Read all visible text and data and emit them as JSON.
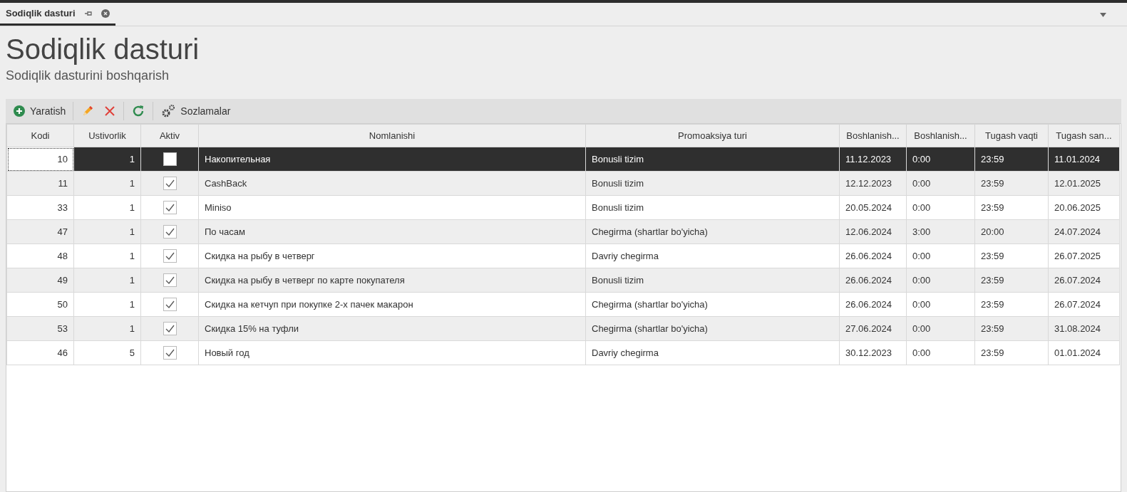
{
  "tabs": [
    {
      "label": "Sodiqlik dasturi",
      "selected": true
    }
  ],
  "page": {
    "title": "Sodiqlik dasturi",
    "subtitle": "Sodiqlik dasturini boshqarish"
  },
  "toolbar": [
    {
      "kind": "create",
      "label": "Yaratish"
    },
    {
      "kind": "edit"
    },
    {
      "kind": "delete"
    },
    {
      "kind": "refresh"
    },
    {
      "kind": "settings",
      "label": "Sozlamalar"
    }
  ],
  "table": {
    "columns": [
      "Kodi",
      "Ustivorlik",
      "Aktiv",
      "Nomlanishi",
      "Promoaksiya turi",
      "Boshlanish...",
      "Boshlanish...",
      "Tugash vaqti",
      "Tugash san..."
    ],
    "rows": [
      {
        "selected": true,
        "kodi": "10",
        "ustivorlik": "1",
        "aktiv": false,
        "name": "Накопительная",
        "type": "Bonusli tizim",
        "start_date": "11.12.2023",
        "start_time": "0:00",
        "end_time": "23:59",
        "end_date": "11.01.2024"
      },
      {
        "selected": false,
        "kodi": "11",
        "ustivorlik": "1",
        "aktiv": true,
        "name": "CashBack",
        "type": "Bonusli tizim",
        "start_date": "12.12.2023",
        "start_time": "0:00",
        "end_time": "23:59",
        "end_date": "12.01.2025"
      },
      {
        "selected": false,
        "kodi": "33",
        "ustivorlik": "1",
        "aktiv": true,
        "name": "Miniso",
        "type": "Bonusli tizim",
        "start_date": "20.05.2024",
        "start_time": "0:00",
        "end_time": "23:59",
        "end_date": "20.06.2025"
      },
      {
        "selected": false,
        "kodi": "47",
        "ustivorlik": "1",
        "aktiv": true,
        "name": "По часам",
        "type": "Chegirma (shartlar bo'yicha)",
        "start_date": "12.06.2024",
        "start_time": "3:00",
        "end_time": "20:00",
        "end_date": "24.07.2024"
      },
      {
        "selected": false,
        "kodi": "48",
        "ustivorlik": "1",
        "aktiv": true,
        "name": "Скидка на рыбу в четверг",
        "type": "Davriy chegirma",
        "start_date": "26.06.2024",
        "start_time": "0:00",
        "end_time": "23:59",
        "end_date": "26.07.2025"
      },
      {
        "selected": false,
        "kodi": "49",
        "ustivorlik": "1",
        "aktiv": true,
        "name": "Скидка на рыбу в четверг по карте покупателя",
        "type": "Bonusli tizim",
        "start_date": "26.06.2024",
        "start_time": "0:00",
        "end_time": "23:59",
        "end_date": "26.07.2024"
      },
      {
        "selected": false,
        "kodi": "50",
        "ustivorlik": "1",
        "aktiv": true,
        "name": "Скидка на кетчуп при покупке 2-х пачек макарон",
        "type": "Chegirma (shartlar bo'yicha)",
        "start_date": "26.06.2024",
        "start_time": "0:00",
        "end_time": "23:59",
        "end_date": "26.07.2024"
      },
      {
        "selected": false,
        "kodi": "53",
        "ustivorlik": "1",
        "aktiv": true,
        "name": "Скидка 15% на туфли",
        "type": "Chegirma (shartlar bo'yicha)",
        "start_date": "27.06.2024",
        "start_time": "0:00",
        "end_time": "23:59",
        "end_date": "31.08.2024"
      },
      {
        "selected": false,
        "kodi": "46",
        "ustivorlik": "5",
        "aktiv": true,
        "name": "Новый год",
        "type": "Davriy chegirma",
        "start_date": "30.12.2023",
        "start_time": "0:00",
        "end_time": "23:59",
        "end_date": "01.01.2024"
      }
    ]
  }
}
